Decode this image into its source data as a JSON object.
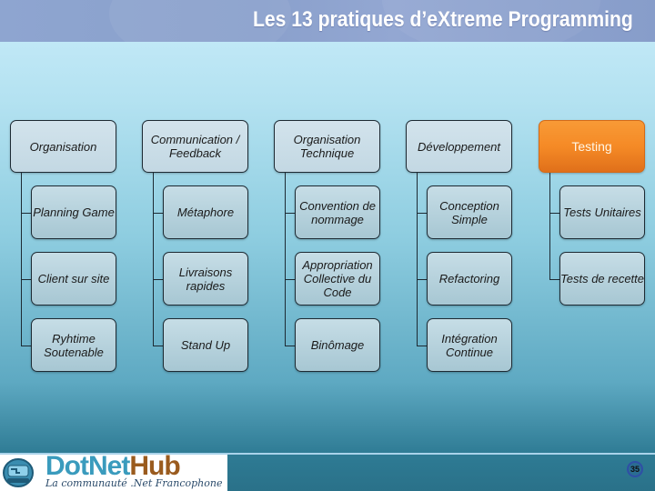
{
  "slide": {
    "title": "Les 13 pratiques d’eXtreme Programming",
    "page_number": "35"
  },
  "columns": [
    {
      "header": "Organisation",
      "highlighted": false,
      "items": [
        "Planning Game",
        "Client sur site",
        "Ryhtime Soutenable"
      ]
    },
    {
      "header": "Communication / Feedback",
      "highlighted": false,
      "items": [
        "Métaphore",
        "Livraisons rapides",
        "Stand Up"
      ]
    },
    {
      "header": "Organisation Technique",
      "highlighted": false,
      "items": [
        "Convention de nommage",
        "Appropriation Collective du Code",
        "Binômage"
      ]
    },
    {
      "header": "Développement",
      "highlighted": false,
      "items": [
        "Conception Simple",
        "Refactoring",
        "Intégration Continue"
      ]
    },
    {
      "header": "Testing",
      "highlighted": true,
      "items": [
        "Tests Unitaires",
        "Tests de recette"
      ]
    }
  ],
  "footer": {
    "logo_part1": "DotNet",
    "logo_part2": "Hub",
    "tagline": "La communauté .Net Francophone",
    "logo_icon": "dotnethub-logo-icon"
  },
  "colors": {
    "accent": "#f58a26",
    "header_band": "#8aa0cc",
    "box_fill": "#c3d8e3"
  }
}
